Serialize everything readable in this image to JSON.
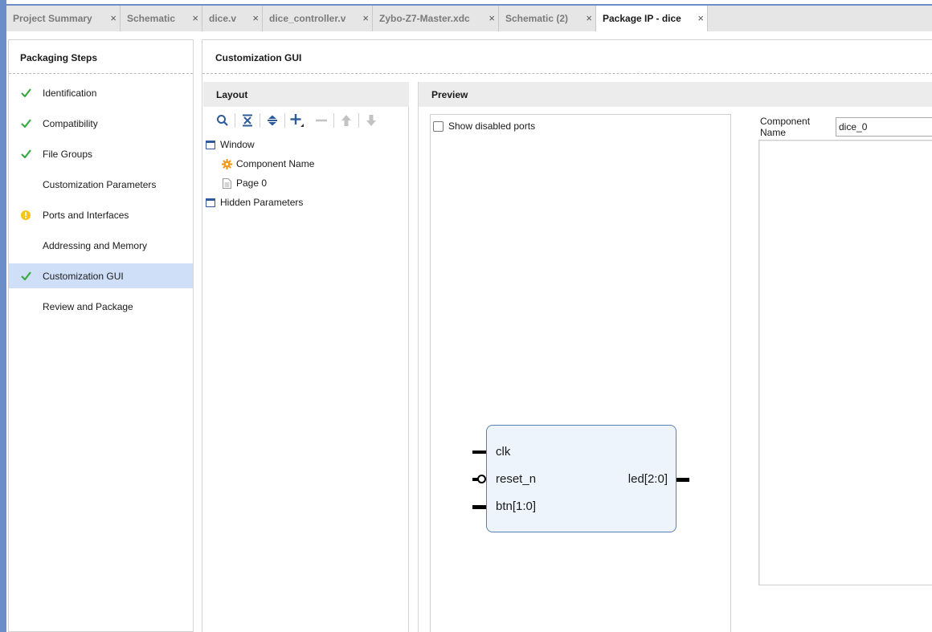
{
  "tabs": [
    {
      "label": "Project Summary",
      "active": false
    },
    {
      "label": "Schematic",
      "active": false
    },
    {
      "label": "dice.v",
      "active": false
    },
    {
      "label": "dice_controller.v",
      "active": false
    },
    {
      "label": "Zybo-Z7-Master.xdc",
      "active": false
    },
    {
      "label": "Schematic (2)",
      "active": false
    },
    {
      "label": "Package IP - dice",
      "active": true
    }
  ],
  "tab_close_glyph": "×",
  "packaging": {
    "title": "Packaging Steps",
    "steps": [
      {
        "label": "Identification",
        "status": "check",
        "selected": false
      },
      {
        "label": "Compatibility",
        "status": "check",
        "selected": false
      },
      {
        "label": "File Groups",
        "status": "check",
        "selected": false
      },
      {
        "label": "Customization Parameters",
        "status": "none",
        "selected": false
      },
      {
        "label": "Ports and Interfaces",
        "status": "warning",
        "selected": false
      },
      {
        "label": "Addressing and Memory",
        "status": "none",
        "selected": false
      },
      {
        "label": "Customization GUI",
        "status": "check",
        "selected": true
      },
      {
        "label": "Review and Package",
        "status": "none",
        "selected": false
      }
    ]
  },
  "main": {
    "title": "Customization GUI"
  },
  "layout": {
    "title": "Layout",
    "toolbar": [
      "search-icon",
      "collapse-all-icon",
      "expand-all-icon",
      "add-icon",
      "remove-icon",
      "move-up-icon",
      "move-down-icon"
    ],
    "tree": [
      {
        "label": "Window",
        "icon": "window-icon"
      },
      {
        "label": "Component Name",
        "icon": "gear-icon"
      },
      {
        "label": "Page 0",
        "icon": "page-icon"
      },
      {
        "label": "Hidden Parameters",
        "icon": "window-icon"
      }
    ]
  },
  "preview": {
    "title": "Preview",
    "show_disabled_ports_label": "Show disabled ports",
    "show_disabled_ports_checked": false,
    "component_name_label": "Component Name",
    "component_name_value": "dice_0",
    "block": {
      "inputs": [
        "clk",
        "reset_n",
        "btn[1:0]"
      ],
      "outputs": [
        "led[2:0]"
      ]
    }
  },
  "colors": {
    "accent": "#6b8ec9",
    "check": "#3aa845",
    "warning": "#f5c518",
    "selected_row": "#cfdff7",
    "gear": "#f29a1f",
    "block_fill": "#eef4fb",
    "block_border": "#5a7fb5"
  }
}
